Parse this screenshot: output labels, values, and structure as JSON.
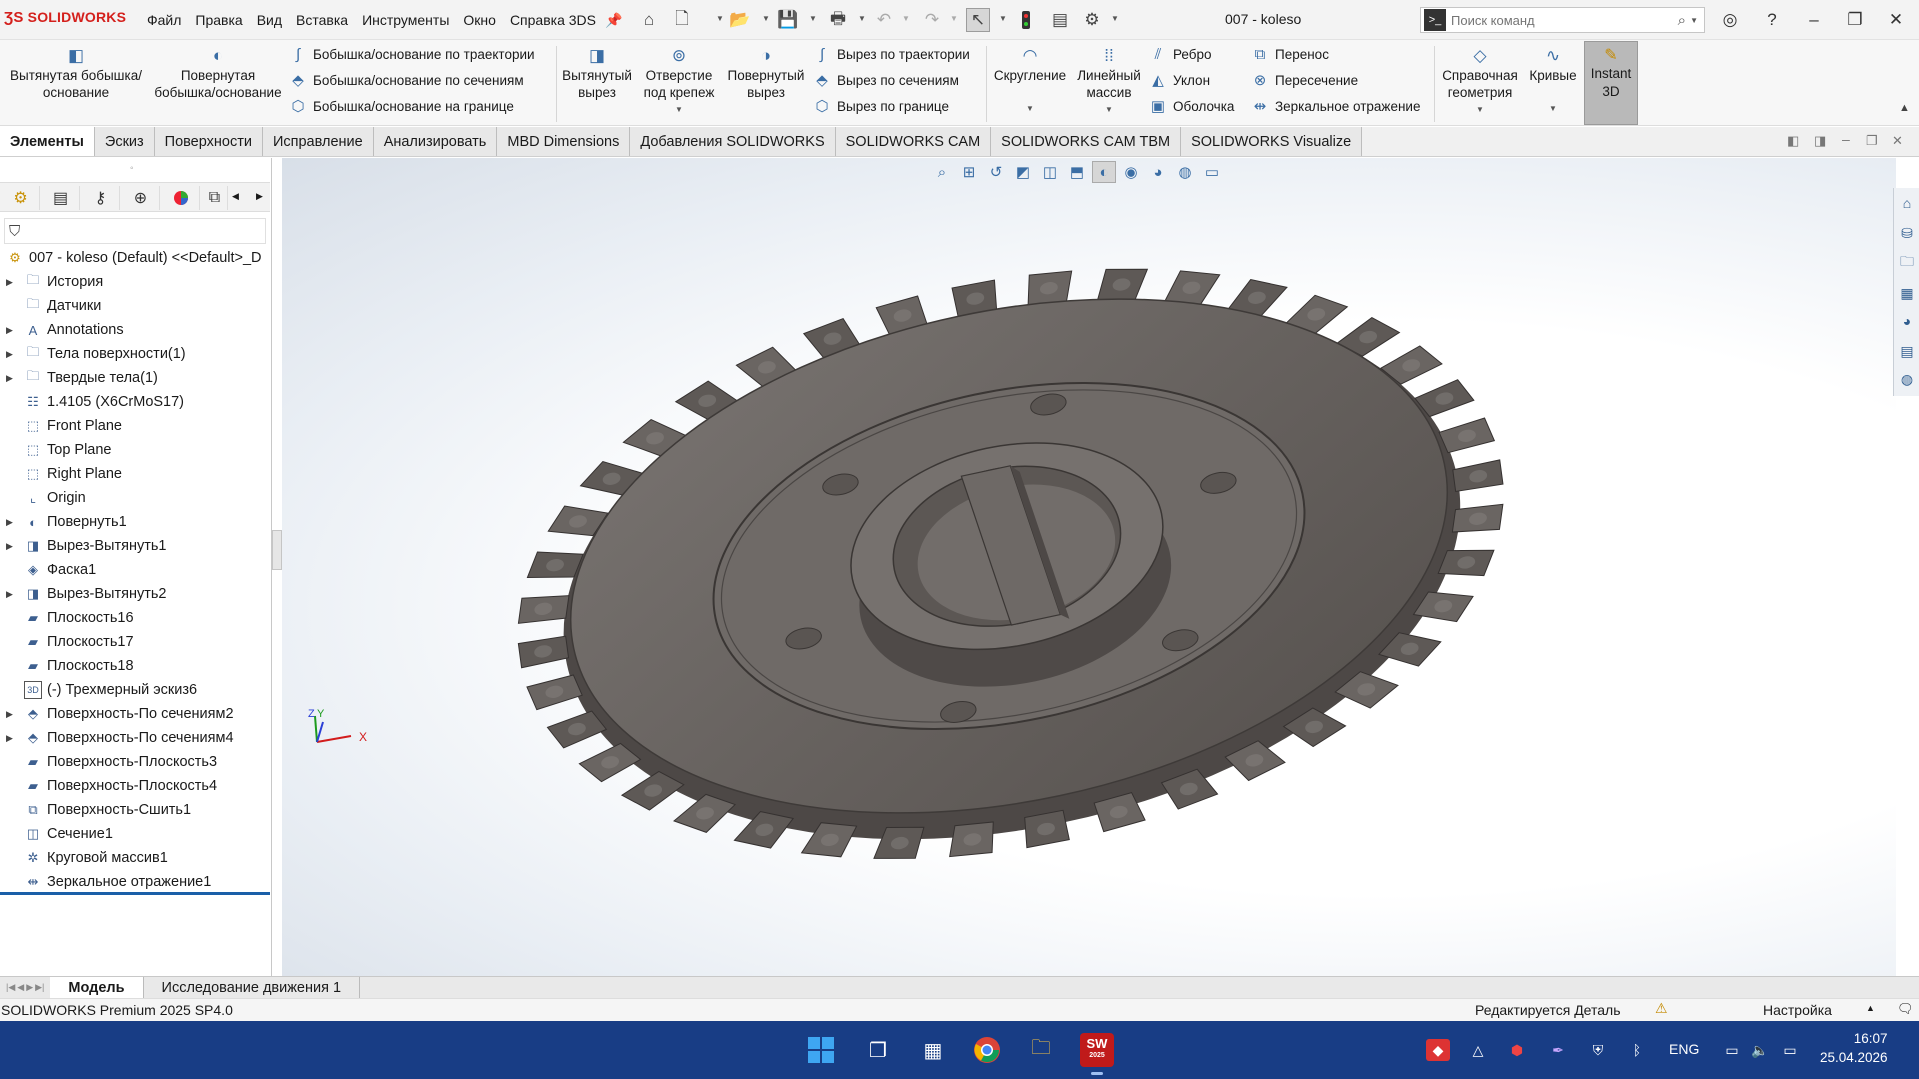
{
  "app": {
    "logo": "SOLIDWORKS",
    "document_title": "007 - koleso",
    "colors": {
      "brand": "#d4201c",
      "taskbar": "#183d85",
      "feature_icon": "#3b6ea5",
      "model": "#6b6663"
    }
  },
  "menu": {
    "items": [
      "Файл",
      "Правка",
      "Вид",
      "Вставка",
      "Инструменты",
      "Окно",
      "Справка 3DS"
    ]
  },
  "quick_access": {
    "icons": [
      "pin-icon",
      "home-icon",
      "new-icon",
      "open-icon",
      "save-icon",
      "print-icon",
      "undo-icon",
      "redo-icon",
      "select-icon",
      "rebuild-icon",
      "file-properties-icon",
      "options-icon"
    ]
  },
  "search": {
    "placeholder": "Поиск команд"
  },
  "ribbon": {
    "extruded_boss": "Вытянутая бобышка/основание",
    "revolved_boss": "Повернутая бобышка/основание",
    "swept_boss": "Бобышка/основание по траектории",
    "lofted_boss": "Бобышка/основание по сечениям",
    "boundary_boss": "Бобышка/основание на границе",
    "extruded_cut": "Вытянутый вырез",
    "hole_wizard": "Отверстие под крепеж",
    "revolved_cut": "Повернутый вырез",
    "swept_cut": "Вырез по траектории",
    "lofted_cut": "Вырез по сечениям",
    "boundary_cut": "Вырез по границе",
    "fillet": "Скругление",
    "linear_pattern": "Линейный массив",
    "rib": "Ребро",
    "draft": "Уклон",
    "shell": "Оболочка",
    "wrap": "Перенос",
    "intersect": "Пересечение",
    "mirror": "Зеркальное отражение",
    "reference_geometry": "Справочная геометрия",
    "curves": "Кривые",
    "instant3d": "Instant 3D"
  },
  "tabs": [
    "Элементы",
    "Эскиз",
    "Поверхности",
    "Исправление",
    "Анализировать",
    "MBD Dimensions",
    "Добавления SOLIDWORKS",
    "SOLIDWORKS CAM",
    "SOLIDWORKS CAM TBM",
    "SOLIDWORKS Visualize"
  ],
  "tree": {
    "root": "007 - koleso (Default) <<Default>_D",
    "items": [
      {
        "label": "История",
        "icon": "history-folder-icon",
        "expandable": true
      },
      {
        "label": "Датчики",
        "icon": "sensors-folder-icon",
        "expandable": false
      },
      {
        "label": "Annotations",
        "icon": "annotations-folder-icon",
        "expandable": true
      },
      {
        "label": "Тела поверхности(1)",
        "icon": "surface-bodies-folder-icon",
        "expandable": true
      },
      {
        "label": "Твердые тела(1)",
        "icon": "solid-bodies-folder-icon",
        "expandable": true
      },
      {
        "label": "1.4105 (X6CrMoS17)",
        "icon": "material-icon",
        "expandable": false
      },
      {
        "label": "Front Plane",
        "icon": "plane-icon",
        "expandable": false
      },
      {
        "label": "Top Plane",
        "icon": "plane-icon",
        "expandable": false
      },
      {
        "label": "Right Plane",
        "icon": "plane-icon",
        "expandable": false
      },
      {
        "label": "Origin",
        "icon": "origin-icon",
        "expandable": false
      },
      {
        "label": "Повернуть1",
        "icon": "revolve-feature-icon",
        "expandable": true
      },
      {
        "label": "Вырез-Вытянуть1",
        "icon": "cut-extrude-feature-icon",
        "expandable": true
      },
      {
        "label": "Фаска1",
        "icon": "chamfer-feature-icon",
        "expandable": false
      },
      {
        "label": "Вырез-Вытянуть2",
        "icon": "cut-extrude-feature-icon",
        "expandable": true
      },
      {
        "label": "Плоскость16",
        "icon": "ref-plane-icon",
        "expandable": false
      },
      {
        "label": "Плоскость17",
        "icon": "ref-plane-icon",
        "expandable": false
      },
      {
        "label": "Плоскость18",
        "icon": "ref-plane-icon",
        "expandable": false
      },
      {
        "label": "(-) Трехмерный эскиз6",
        "icon": "3d-sketch-icon",
        "expandable": false
      },
      {
        "label": "Поверхность-По сечениям2",
        "icon": "loft-surface-icon",
        "expandable": true
      },
      {
        "label": "Поверхность-По сечениям4",
        "icon": "loft-surface-icon",
        "expandable": true
      },
      {
        "label": "Поверхность-Плоскость3",
        "icon": "planar-surface-icon",
        "expandable": false
      },
      {
        "label": "Поверхность-Плоскость4",
        "icon": "planar-surface-icon",
        "expandable": false
      },
      {
        "label": "Поверхность-Сшить1",
        "icon": "knit-surface-icon",
        "expandable": false
      },
      {
        "label": "Сечение1",
        "icon": "section-icon",
        "expandable": false
      },
      {
        "label": "Круговой массив1",
        "icon": "circular-pattern-icon",
        "expandable": false
      },
      {
        "label": "Зеркальное отражение1",
        "icon": "mirror-feature-icon",
        "expandable": false
      }
    ]
  },
  "bottom_tabs": [
    "Модель",
    "Исследование движения 1"
  ],
  "status": {
    "left": "SOLIDWORKS Premium 2025 SP4.0",
    "mode": "Редактируется Деталь",
    "units": "Настройка"
  },
  "triad": {
    "z": "Z",
    "y": "Y",
    "x": "X"
  },
  "taskbar": {
    "language": "ENG",
    "time": "16:07",
    "date": "25.04.2026",
    "sw_badge": "SW",
    "sw_year": "2025"
  }
}
